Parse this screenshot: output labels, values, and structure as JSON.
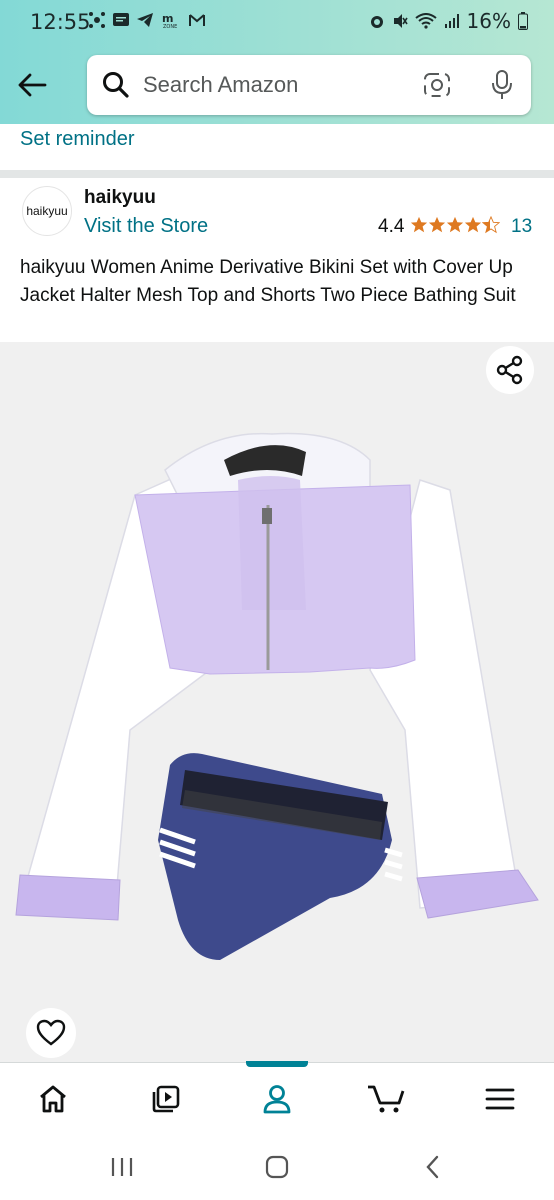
{
  "status_bar": {
    "time": "12:55",
    "battery": "16%"
  },
  "search": {
    "placeholder": "Search Amazon"
  },
  "reminder": {
    "label": "Set reminder"
  },
  "store": {
    "logo_text": "haikyuu",
    "name": "haikyuu",
    "visit_label": "Visit the Store",
    "rating": "4.4",
    "stars": 4.4,
    "rating_count": "13"
  },
  "product": {
    "title": "haikyuu Women Anime Derivative Bikini Set with Cover Up Jacket Halter Mesh Top and Shorts Two Piece Bathing Suit"
  },
  "bottom_nav": {
    "items": [
      "home-icon",
      "inspire-icon",
      "account-icon",
      "cart-icon",
      "menu-icon"
    ],
    "active_index": 2,
    "accent": "#008296"
  },
  "colors": {
    "link": "#007185",
    "star": "#de7921",
    "header_start": "#83d9d6",
    "header_end": "#b6e7d3"
  }
}
